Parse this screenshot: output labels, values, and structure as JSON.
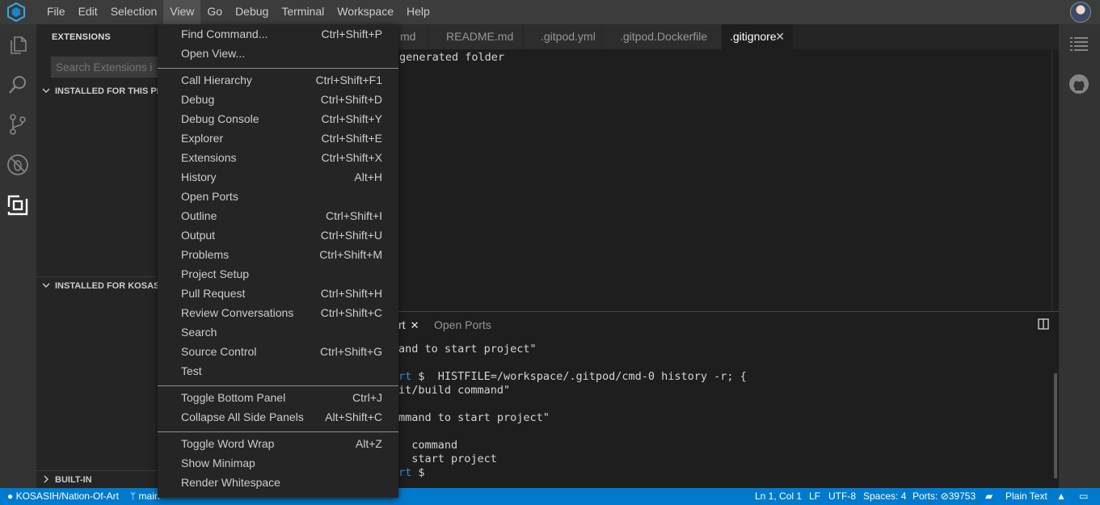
{
  "menubar": {
    "items": [
      "File",
      "Edit",
      "Selection",
      "View",
      "Go",
      "Debug",
      "Terminal",
      "Workspace",
      "Help"
    ],
    "active": "View"
  },
  "sidebar": {
    "title": "EXTENSIONS",
    "search_placeholder": "Search Extensions in",
    "sections": [
      "INSTALLED FOR THIS PR",
      "INSTALLED FOR KOSASI",
      "BUILT-IN"
    ]
  },
  "tabs": [
    "md",
    "README.md",
    ".gitpod.yml",
    ".gitpod.Dockerfile",
    ".gitignore"
  ],
  "active_tab": ".gitignore",
  "editor": {
    "line1": "generated folder"
  },
  "panel": {
    "tabs": {
      "terminal": "rt",
      "ports": "Open Ports"
    },
    "lines": [
      {
        "pre": "",
        "text": "and to start project\""
      },
      {
        "pre": "rt",
        "text": " $  HISTFILE=/workspace/.gitpod/cmd-0 history -r; {"
      },
      {
        "pre": "",
        "text": "it/build command\""
      },
      {
        "pre": "",
        "text": "mmand to start project\""
      },
      {
        "pre": "",
        "text": "  command"
      },
      {
        "pre": "",
        "text": "  start project"
      },
      {
        "pre": "rt",
        "text": " $"
      }
    ]
  },
  "view_menu": {
    "groups": [
      [
        {
          "label": "Find Command...",
          "key": "Ctrl+Shift+P"
        },
        {
          "label": "Open View...",
          "key": ""
        }
      ],
      [
        {
          "label": "Call Hierarchy",
          "key": "Ctrl+Shift+F1"
        },
        {
          "label": "Debug",
          "key": "Ctrl+Shift+D"
        },
        {
          "label": "Debug Console",
          "key": "Ctrl+Shift+Y"
        },
        {
          "label": "Explorer",
          "key": "Ctrl+Shift+E"
        },
        {
          "label": "Extensions",
          "key": "Ctrl+Shift+X"
        },
        {
          "label": "History",
          "key": "Alt+H"
        },
        {
          "label": "Open Ports",
          "key": ""
        },
        {
          "label": "Outline",
          "key": "Ctrl+Shift+I"
        },
        {
          "label": "Output",
          "key": "Ctrl+Shift+U"
        },
        {
          "label": "Problems",
          "key": "Ctrl+Shift+M"
        },
        {
          "label": "Project Setup",
          "key": ""
        },
        {
          "label": "Pull Request",
          "key": "Ctrl+Shift+H"
        },
        {
          "label": "Review Conversations",
          "key": "Ctrl+Shift+C"
        },
        {
          "label": "Search",
          "key": ""
        },
        {
          "label": "Source Control",
          "key": "Ctrl+Shift+G"
        },
        {
          "label": "Test",
          "key": ""
        }
      ],
      [
        {
          "label": "Toggle Bottom Panel",
          "key": "Ctrl+J"
        },
        {
          "label": "Collapse All Side Panels",
          "key": "Alt+Shift+C"
        }
      ],
      [
        {
          "label": "Toggle Word Wrap",
          "key": "Alt+Z"
        },
        {
          "label": "Show Minimap",
          "key": ""
        },
        {
          "label": "Render Whitespace",
          "key": ""
        }
      ]
    ]
  },
  "statusbar": {
    "repo": "KOSASIH/Nation-Of-Art",
    "branch": "main",
    "position": "Ln 1, Col 1",
    "eol": "LF",
    "encoding": "UTF-8",
    "spaces": "Spaces: 4",
    "ports_label": "Ports:",
    "ports_value": "39753",
    "language": "Plain Text"
  },
  "colors": {
    "statusbar": "#007acc",
    "menu_bg": "#252526",
    "accent": "#3b8eea"
  }
}
